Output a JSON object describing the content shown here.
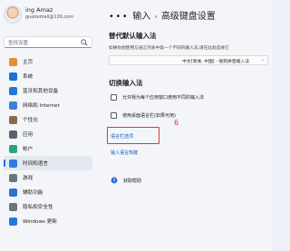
{
  "account": {
    "name": "ing Amaz",
    "email": "guodemail@126.com"
  },
  "search": {
    "placeholder": "查找设置"
  },
  "nav": {
    "items": [
      {
        "label": "主页",
        "icon": "home-icon",
        "color": "#e58b3a",
        "active": false
      },
      {
        "label": "系统",
        "icon": "system-icon",
        "color": "#1f6fd1",
        "active": false
      },
      {
        "label": "蓝牙和其他设备",
        "icon": "bluetooth-icon",
        "color": "#2476d6",
        "active": false
      },
      {
        "label": "网络和 Internet",
        "icon": "wifi-icon",
        "color": "#3b7fd8",
        "active": false
      },
      {
        "label": "个性化",
        "icon": "personalization-icon",
        "color": "#8a6a4f",
        "active": false
      },
      {
        "label": "应用",
        "icon": "apps-icon",
        "color": "#5a6270",
        "active": false
      },
      {
        "label": "帐户",
        "icon": "account-icon",
        "color": "#2aa37a",
        "active": false
      },
      {
        "label": "时间和语言",
        "icon": "time-language-icon",
        "color": "#2c7be0",
        "active": true
      },
      {
        "label": "游戏",
        "icon": "gaming-icon",
        "color": "#6b7280",
        "active": false
      },
      {
        "label": "辅助功能",
        "icon": "accessibility-icon",
        "color": "#2c73c9",
        "active": false
      },
      {
        "label": "隐私和安全性",
        "icon": "privacy-icon",
        "color": "#6b7280",
        "active": false
      },
      {
        "label": "Windows 更新",
        "icon": "windows-update-icon",
        "color": "#1f7ae0",
        "active": false
      }
    ]
  },
  "breadcrumb": {
    "dots": "•••",
    "parent": "输入",
    "current": "高级键盘设置"
  },
  "override": {
    "heading": "替代默认输入法",
    "description": "如果你想使用与语言列表中第一个不同的输入法,请在此处选择它",
    "select_value": "中文(简体, 中国) - 搜狗拼音输入法"
  },
  "switching": {
    "heading": "切换输入法",
    "option1": "允许我为每个应用窗口使用不同的输入法",
    "option2": "使用桌面语言栏(如果可用)",
    "link_language_bar": "语言栏选项",
    "link_hotkeys": "输入语言热键"
  },
  "annotation": {
    "step": "6"
  },
  "help": {
    "label": "获取帮助"
  }
}
